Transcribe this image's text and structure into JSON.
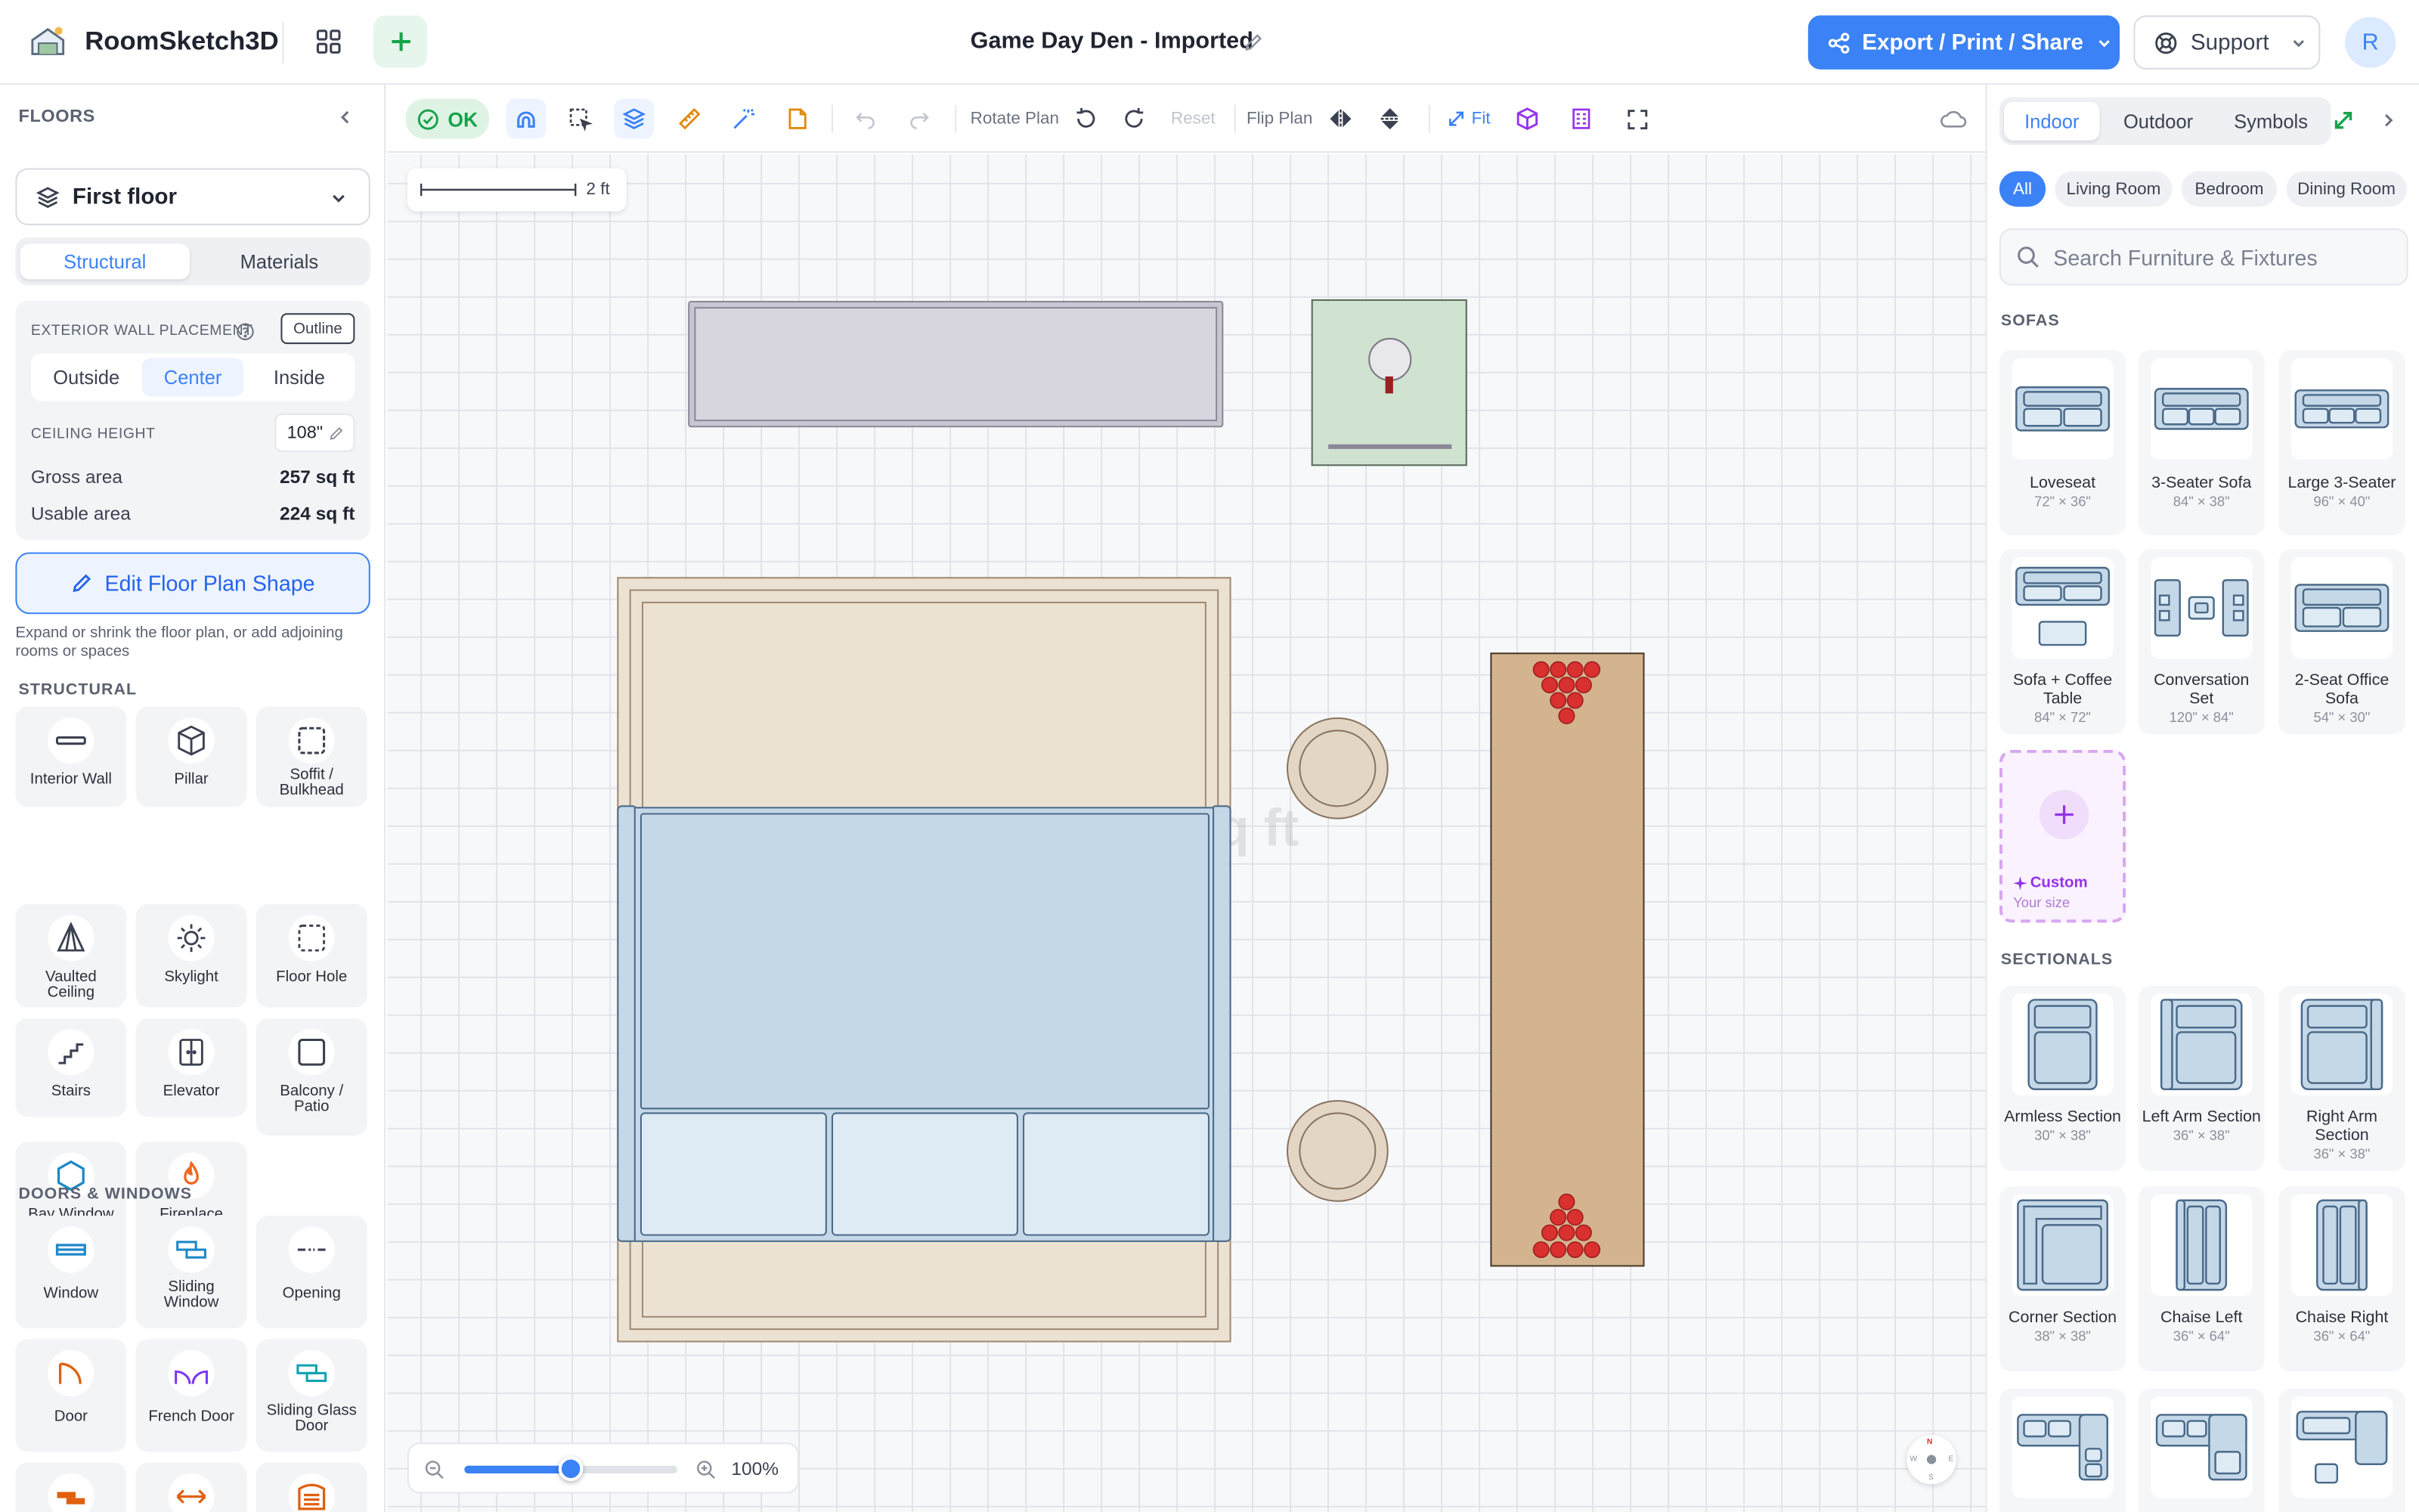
{
  "header": {
    "app_name": "RoomSketch3D",
    "title": "Game Day Den - Imported",
    "export_label": "Export / Print / Share",
    "support_label": "Support",
    "avatar_initial": "R"
  },
  "left": {
    "floors_title": "FLOORS",
    "floor_selected": "First floor",
    "tabs": [
      "Structural",
      "Materials"
    ],
    "active_tab": "Structural",
    "wall_placement_label": "EXTERIOR WALL PLACEMENT",
    "outline_btn": "Outline",
    "placements": [
      "Outside",
      "Center",
      "Inside"
    ],
    "active_placement": "Center",
    "ceiling_label": "CEILING HEIGHT",
    "ceiling_value": "108\"",
    "gross_label": "Gross area",
    "gross_value": "257 sq ft",
    "usable_label": "Usable area",
    "usable_value": "224 sq ft",
    "edit_btn": "Edit Floor Plan Shape",
    "edit_hint": "Expand or shrink the floor plan, or add adjoining rooms or spaces",
    "structural_title": "STRUCTURAL",
    "structural": [
      "Interior Wall",
      "Pillar",
      "Soffit / Bulkhead",
      "Vaulted Ceiling",
      "Skylight",
      "Floor Hole",
      "Stairs",
      "Elevator",
      "Balcony / Patio",
      "Bay Window",
      "Fireplace"
    ],
    "doors_title": "DOORS & WINDOWS",
    "doors": [
      "Window",
      "Sliding Window",
      "Opening",
      "Door",
      "French Door",
      "Sliding Glass Door"
    ]
  },
  "toolbar": {
    "ok": "OK",
    "rotate_plan": "Rotate Plan",
    "reset": "Reset",
    "flip_plan": "Flip Plan",
    "fit": "Fit"
  },
  "canvas": {
    "scale_label": "2 ft",
    "watermark": "q ft",
    "zoom_pct": "100%",
    "zoom_level": 0.5,
    "compass": [
      "N",
      "W",
      "E",
      "S"
    ]
  },
  "right": {
    "tabs": [
      "Indoor",
      "Outdoor",
      "Symbols"
    ],
    "active_tab": "Indoor",
    "chips": [
      "All",
      "Living Room",
      "Bedroom",
      "Dining Room"
    ],
    "search_placeholder": "Search Furniture & Fixtures",
    "sofas_title": "SOFAS",
    "sofas": [
      {
        "name": "Loveseat",
        "dim": "72\" × 36\""
      },
      {
        "name": "3-Seater Sofa",
        "dim": "84\" × 38\""
      },
      {
        "name": "Large 3-Seater",
        "dim": "96\" × 40\""
      },
      {
        "name": "Sofa + Coffee Table",
        "dim": "84\" × 72\""
      },
      {
        "name": "Conversation Set",
        "dim": "120\" × 84\""
      },
      {
        "name": "2-Seat Office Sofa",
        "dim": "54\" × 30\""
      }
    ],
    "custom_name": "Custom",
    "custom_sub": "Your size",
    "sectionals_title": "SECTIONALS",
    "sectionals": [
      {
        "name": "Armless Section",
        "dim": "30\" × 38\""
      },
      {
        "name": "Left Arm Section",
        "dim": "36\" × 38\""
      },
      {
        "name": "Right Arm Section",
        "dim": "36\" × 38\""
      },
      {
        "name": "Corner Section",
        "dim": "38\" × 38\""
      },
      {
        "name": "Chaise Left",
        "dim": "36\" × 64\""
      },
      {
        "name": "Chaise Right",
        "dim": "36\" × 64\""
      }
    ]
  },
  "colors": {
    "accent": "#3b82f6",
    "ok_green": "#16a34a",
    "rug": "#ece2d3",
    "sofa_fill": "#c5d8e8",
    "table_wood": "#d3b48f",
    "cup_red": "#d93030"
  }
}
